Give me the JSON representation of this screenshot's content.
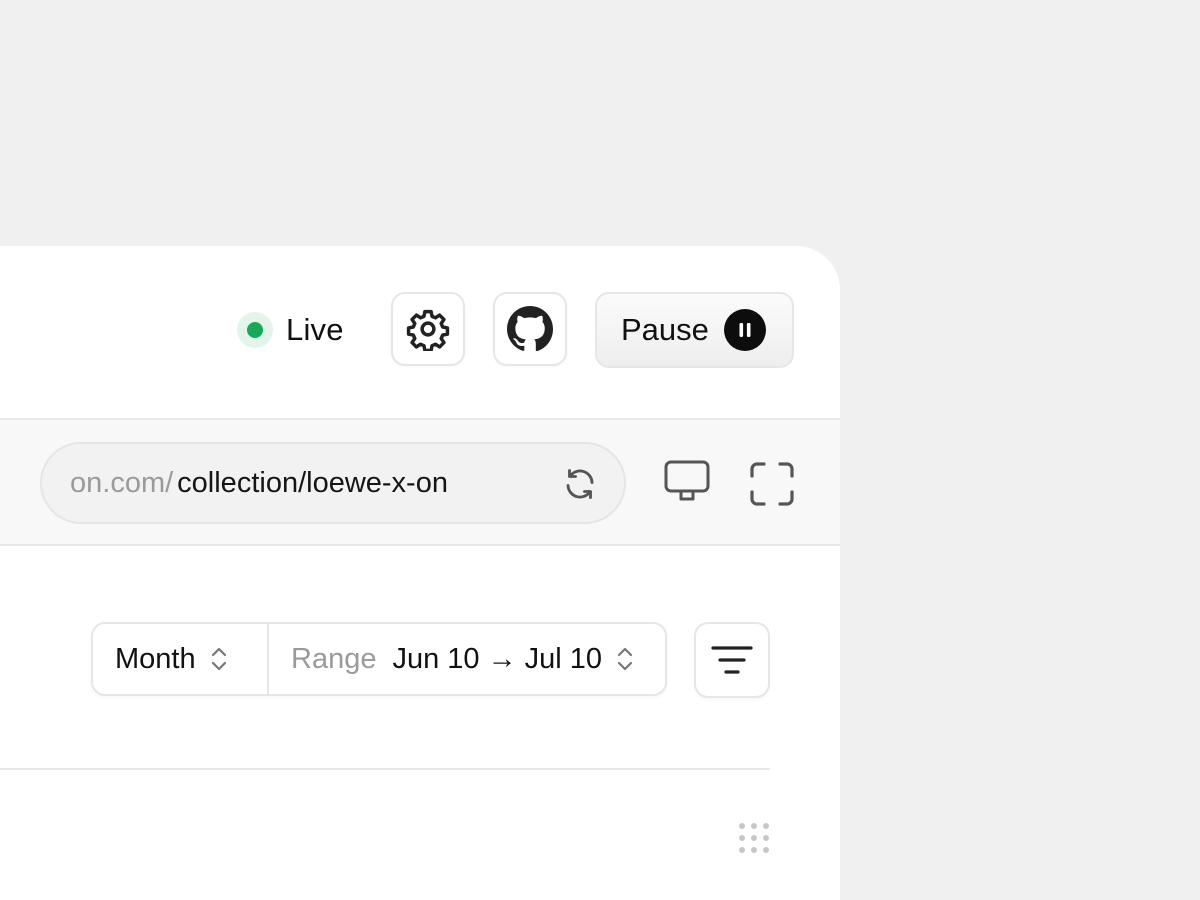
{
  "topbar": {
    "status_label": "Live",
    "status_color": "#18a957",
    "settings_icon": "gear-icon",
    "github_icon": "github-icon",
    "pause_label": "Pause",
    "pause_icon": "pause-icon"
  },
  "address_bar": {
    "host": "on.com/",
    "path": "collection/loewe-x-on",
    "reload_icon": "refresh-icon",
    "device_icon": "monitor-icon",
    "fullscreen_icon": "fullscreen-icon"
  },
  "filters": {
    "period_value": "Month",
    "range_label": "Range",
    "range_value": "Jun 10 → Jul 10",
    "filter_icon": "filter-icon"
  },
  "footer": {
    "handle_icon": "drag-handle-icon"
  }
}
